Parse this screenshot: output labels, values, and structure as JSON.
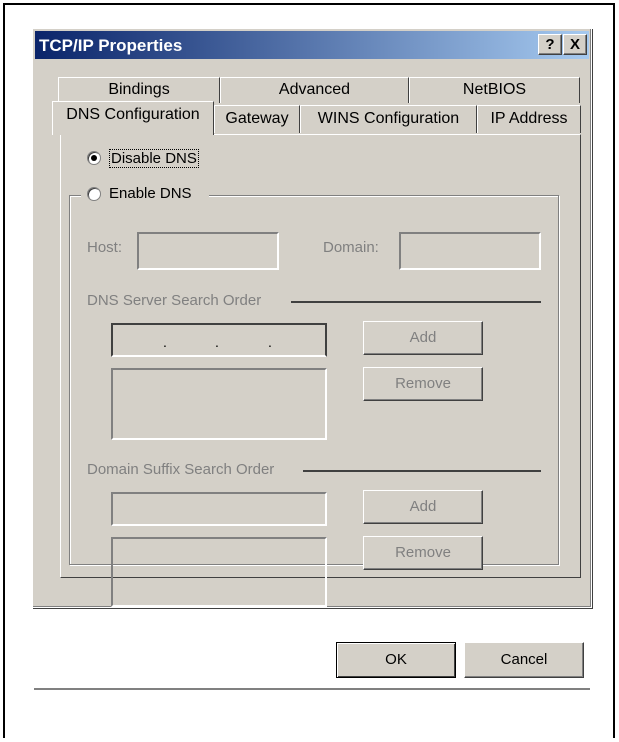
{
  "window": {
    "title": "TCP/IP Properties",
    "help_button": "?",
    "close_button": "X"
  },
  "tabs_back": [
    "Bindings",
    "Advanced",
    "NetBIOS"
  ],
  "tabs_front": [
    "DNS Configuration",
    "Gateway",
    "WINS Configuration",
    "IP Address"
  ],
  "active_tab": "DNS Configuration",
  "dns": {
    "disable_label": "Disable DNS",
    "enable_label": "Enable DNS",
    "selected": "disable",
    "host_label": "Host:",
    "domain_label": "Domain:",
    "host_value": "",
    "domain_value": "",
    "server_order_label": "DNS Server Search Order",
    "server_add": "Add",
    "server_remove": "Remove",
    "suffix_order_label": "Domain Suffix Search Order",
    "suffix_add": "Add",
    "suffix_remove": "Remove",
    "ip_separator": "."
  },
  "footer": {
    "ok": "OK",
    "cancel": "Cancel"
  }
}
